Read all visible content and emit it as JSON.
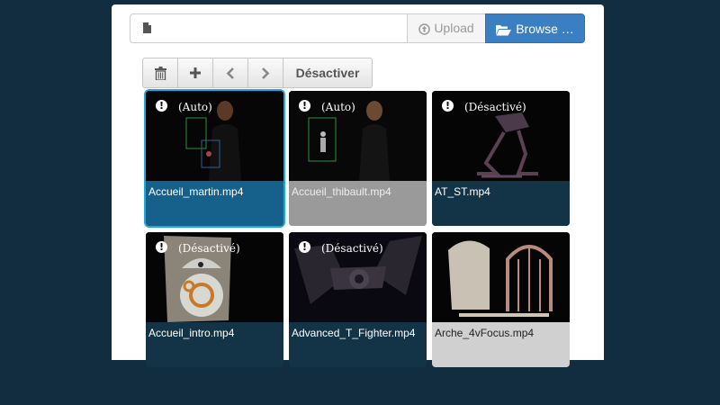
{
  "upload": {
    "file_value": "",
    "upload_label": "Upload",
    "browse_label": "Browse …"
  },
  "toolbar": {
    "delete_icon": "trash-icon",
    "add_icon": "plus-icon",
    "prev_icon": "chevron-left-icon",
    "next_icon": "chevron-right-icon",
    "disable_label": "Désactiver"
  },
  "videos": [
    {
      "name": "Accueil_martin.mp4",
      "status": "(Auto)"
    },
    {
      "name": "Accueil_thibault.mp4",
      "status": "(Auto)"
    },
    {
      "name": "AT_ST.mp4",
      "status": "(Désactivé)"
    },
    {
      "name": "Accueil_intro.mp4",
      "status": "(Désactivé)"
    },
    {
      "name": "Advanced_T_Fighter.mp4",
      "status": "(Désactivé)"
    },
    {
      "name": "Arche_4vFocus.mp4",
      "status": ""
    }
  ],
  "colors": {
    "background": "#122d40",
    "primary": "#3a7fc1",
    "selected_border": "#1ea7e0",
    "caption": "#133447"
  }
}
